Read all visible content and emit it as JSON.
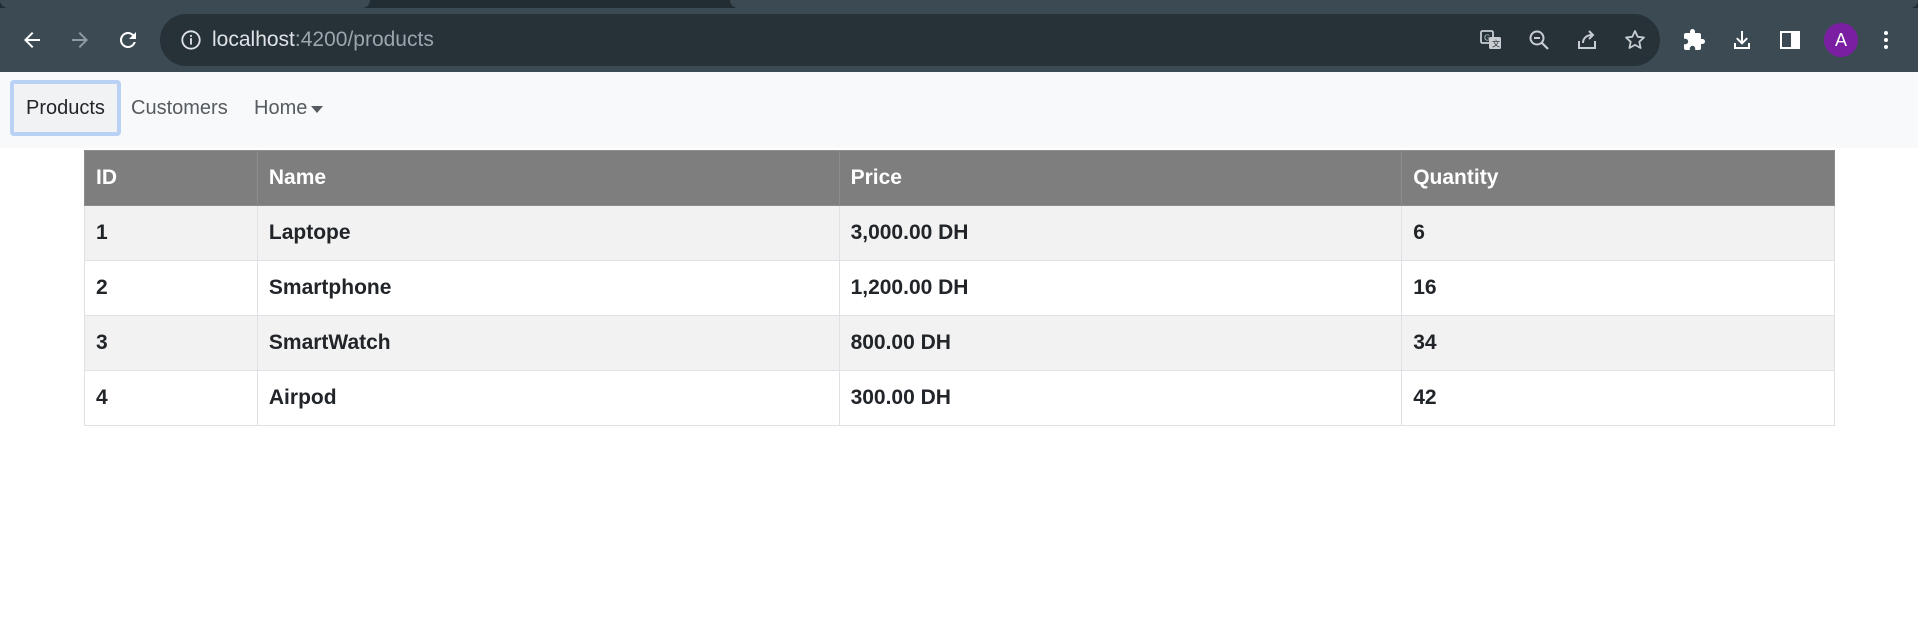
{
  "browser": {
    "url_host": "localhost",
    "url_path": ":4200/products",
    "profile_initial": "A",
    "icons": {
      "back": "arrow-left-icon",
      "forward": "arrow-right-icon",
      "reload": "reload-icon",
      "site_info": "info-icon",
      "translate": "translate-icon",
      "zoom": "zoom-out-icon",
      "share": "share-icon",
      "bookmark": "star-icon",
      "extensions": "puzzle-icon",
      "downloads": "download-icon",
      "side_panel": "side-panel-icon",
      "menu": "kebab-menu-icon"
    },
    "colors": {
      "toolbar": "#3c4a53",
      "omnibox": "#263238",
      "avatar": "#7b1fa2"
    }
  },
  "nav": {
    "items": [
      {
        "label": "Products",
        "active": true
      },
      {
        "label": "Customers",
        "active": false
      },
      {
        "label": "Home",
        "dropdown": true
      }
    ]
  },
  "table": {
    "headers": [
      "ID",
      "Name",
      "Price",
      "Quantity"
    ],
    "rows": [
      [
        "1",
        "Laptope",
        "3,000.00 DH",
        "6"
      ],
      [
        "2",
        "Smartphone",
        "1,200.00 DH",
        "16"
      ],
      [
        "3",
        "SmartWatch",
        "800.00 DH",
        "34"
      ],
      [
        "4",
        "Airpod",
        "300.00 DH",
        "42"
      ]
    ],
    "colors": {
      "header_bg": "#7e7e7e",
      "striped_row": "#f2f2f2"
    }
  }
}
